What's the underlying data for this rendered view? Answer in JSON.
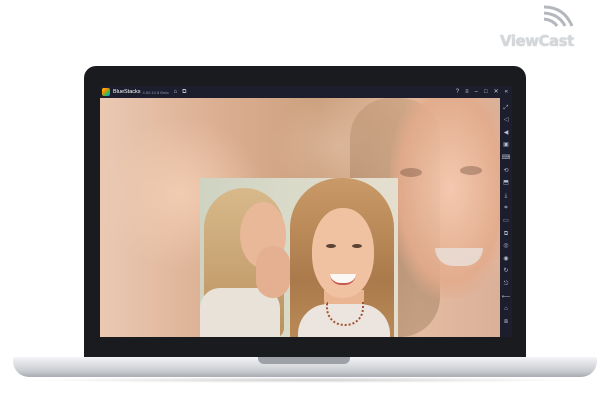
{
  "watermark": {
    "text": "ViewCast"
  },
  "titlebar": {
    "app_name": "BlueStacks",
    "version": "4.60.10.8 Beta",
    "icons": [
      "home-icon",
      "multi-instance-icon"
    ],
    "right_icons": [
      "help-icon",
      "menu-icon",
      "minimize-icon",
      "maximize-icon",
      "close-icon",
      "collapse-sidebar-icon"
    ]
  },
  "glyphs": {
    "home": "⌂",
    "multi": "⧉",
    "help": "?",
    "menu": "≡",
    "minimize": "–",
    "maximize": "□",
    "close": "✕",
    "collapse": "«",
    "sidebar": [
      "⤢",
      "◁",
      "◀",
      "▣",
      "⌨",
      "⟲",
      "⬒",
      "⤓",
      "⌗",
      "▭",
      "⧉",
      "◎",
      "◉",
      "↻",
      "⎋",
      "⟵",
      "⌂",
      "⧈"
    ]
  },
  "sidebar": {
    "icons": [
      "fullscreen-icon",
      "volume-up-icon",
      "volume-down-icon",
      "screen-record-icon",
      "keyboard-icon",
      "rotate-icon",
      "apk-install-icon",
      "screenshot-icon",
      "macro-icon",
      "folder-icon",
      "multi-instance-icon",
      "location-icon",
      "eco-mode-icon",
      "sync-icon",
      "settings-icon",
      "back-icon",
      "home-icon",
      "recent-apps-icon"
    ]
  },
  "colors": {
    "titlebar": "#1c1e2e",
    "bezel": "#1a1b1e"
  }
}
